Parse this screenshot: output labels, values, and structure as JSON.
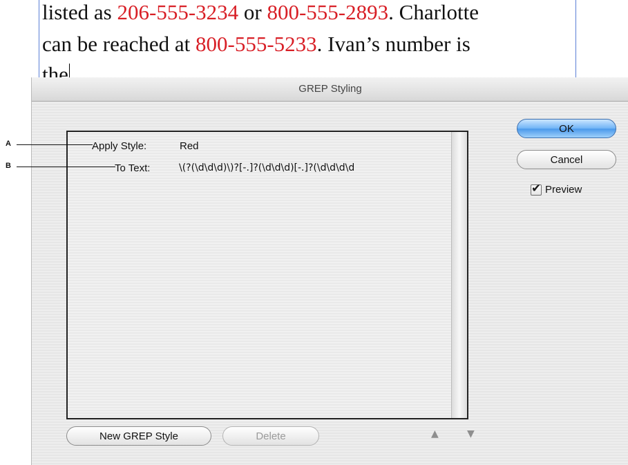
{
  "document": {
    "line1_a": "listed as ",
    "line1_phone1": "206-555-3234",
    "line1_b": " or ",
    "line1_phone2": "800-555-2893",
    "line1_c": ". Charlotte",
    "line2_a": "can be reached at ",
    "line2_phone": "800-555-5233",
    "line2_b": ". Ivan’s number is",
    "line3": "the"
  },
  "dialog": {
    "title": "GREP Styling",
    "rule": {
      "apply_style_label": "Apply Style:",
      "apply_style_value": "Red",
      "to_text_label": "To Text:",
      "to_text_value": "\\(?(\\d\\d\\d)\\)?[-.]?(\\d\\d\\d)[-.]?(\\d\\d\\d\\d"
    },
    "buttons": {
      "ok": "OK",
      "cancel": "Cancel",
      "new_grep_style": "New GREP Style",
      "delete": "Delete"
    },
    "preview_label": "Preview",
    "preview_checked": true
  },
  "callouts": {
    "a": "A",
    "b": "B"
  },
  "colors": {
    "phone_highlight": "#d81f26",
    "ok_button": "#4a98ea"
  },
  "icons": {
    "move_up": "triangle-up-icon",
    "move_down": "triangle-down-icon"
  }
}
